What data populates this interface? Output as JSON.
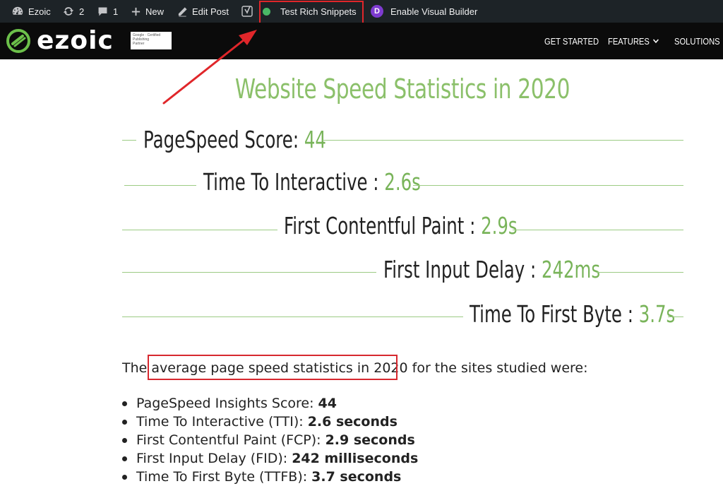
{
  "adminbar": {
    "site_name": "Ezoic",
    "updates_count": "2",
    "comments_count": "1",
    "new_label": "New",
    "edit_post_label": "Edit Post",
    "rich_snippets_label": "Test Rich Snippets",
    "visual_builder_label": "Enable Visual Builder",
    "visual_builder_badge": "D"
  },
  "header": {
    "logo_text": "ezoic",
    "partner_badge": [
      "Google · Certified",
      "Publishing",
      "Partner"
    ],
    "nav": [
      {
        "label": "GET STARTED"
      },
      {
        "label": "FEATURES"
      },
      {
        "label": "SOLUTIONS"
      }
    ]
  },
  "main": {
    "title": "Website Speed Statistics in 2020",
    "stats": [
      {
        "label": "PageSpeed Score:",
        "value": "44"
      },
      {
        "label": "Time To Interactive :",
        "value": "2.6s"
      },
      {
        "label": "First Contentful Paint :",
        "value": "2.9s"
      },
      {
        "label": "First Input Delay :",
        "value": "242ms"
      },
      {
        "label": "Time To First Byte :",
        "value": "3.7s"
      }
    ],
    "paragraph": {
      "before": "The ",
      "highlight": "average page speed statistics in 2020",
      "after": " for the sites studied were:"
    },
    "list": [
      {
        "label": "PageSpeed Insights Score:",
        "value": "44"
      },
      {
        "label": "Time To Interactive (TTI):",
        "value": "2.6 seconds"
      },
      {
        "label": "First Contentful Paint (FCP):",
        "value": "2.9 seconds"
      },
      {
        "label": "First Input Delay (FID):",
        "value": "242 milliseconds"
      },
      {
        "label": "Time To First Byte (TTFB):",
        "value": "3.7 seconds"
      }
    ]
  },
  "colors": {
    "adminbar_bg": "#1d2327",
    "accent_green": "#8bc06a",
    "annotation_red": "#e0262a",
    "divi_purple": "#7e3bd0"
  }
}
